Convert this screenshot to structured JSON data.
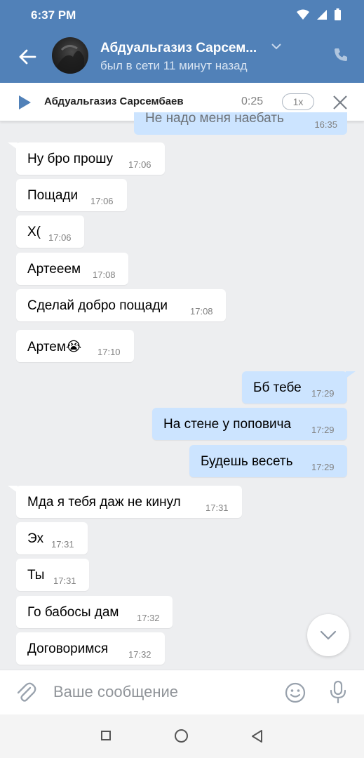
{
  "status_bar": {
    "time": "6:37 PM"
  },
  "header": {
    "name": "Абдуальгазиз Сарсем...",
    "subtitle": "был в сети 11 минут назад"
  },
  "player": {
    "title": "Абдуальгазиз Сарсембаев",
    "duration": "0:25",
    "speed": "1x"
  },
  "clipped_message": {
    "text": "Не надо меня наебать",
    "time": "16:35"
  },
  "messages": [
    {
      "side": "in",
      "text": "Ну бро прошу",
      "time": "17:06"
    },
    {
      "side": "in",
      "text": "Пощади",
      "time": "17:06"
    },
    {
      "side": "in",
      "text": "Х(",
      "time": "17:06"
    },
    {
      "side": "in",
      "text": "Артееем",
      "time": "17:08"
    },
    {
      "side": "in",
      "text": "Сделай добро пощади",
      "time": "17:08"
    },
    {
      "side": "in",
      "text": "Артем😭",
      "time": "17:10"
    },
    {
      "side": "out",
      "text": "Бб тебе",
      "time": "17:29"
    },
    {
      "side": "out",
      "text": "На стене у поповича",
      "time": "17:29"
    },
    {
      "side": "out",
      "text": "Будешь весеть",
      "time": "17:29"
    },
    {
      "side": "in",
      "text": "Мда я тебя даж не кинул",
      "time": "17:31"
    },
    {
      "side": "in",
      "text": "Эх",
      "time": "17:31"
    },
    {
      "side": "in",
      "text": "Ты",
      "time": "17:31"
    },
    {
      "side": "in",
      "text": "Го бабосы дам",
      "time": "17:32"
    },
    {
      "side": "in",
      "text": "Договоримся",
      "time": "17:32"
    }
  ],
  "composer": {
    "placeholder": "Ваше сообщение"
  },
  "colors": {
    "header": "#5181b8",
    "outgoing": "#cce4ff",
    "background": "#edeef0"
  }
}
